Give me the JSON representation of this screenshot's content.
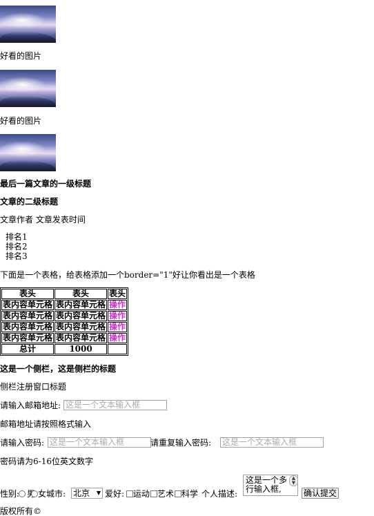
{
  "images": [
    {
      "caption": "好看的图片"
    },
    {
      "caption": "好看的图片"
    },
    {
      "caption": ""
    }
  ],
  "article": {
    "h1": "最后一篇文章的一级标题",
    "h2": "文章的二级标题",
    "meta": "文章作者 文章发表时间",
    "ranks": [
      "排名1",
      "排名2",
      "排名3"
    ],
    "table_intro": "下面是一个表格，给表格添加一个border=\"1\"好让你看出是一个表格"
  },
  "table": {
    "headers": [
      "表头",
      "表头",
      "表头"
    ],
    "rows": [
      [
        "表内容单元格",
        "表内容单元格",
        "操作"
      ],
      [
        "表内容单元格",
        "表内容单元格",
        "操作"
      ],
      [
        "表内容单元格",
        "表内容单元格",
        "操作"
      ],
      [
        "表内容单元格",
        "表内容单元格",
        "操作"
      ]
    ],
    "footer": [
      "总计",
      "1000",
      ""
    ]
  },
  "sidebar": {
    "title": "这是一个侧栏，这是侧栏的标题",
    "window_title": "侧栏注册窗口标题"
  },
  "form": {
    "email_label": "请输入邮箱地址:",
    "email_placeholder": "这是一个文本输入框",
    "email_hint": "邮箱地址请按照格式输入",
    "password_label": "请输入密码:",
    "password_placeholder": "这是一个文本输入框",
    "password2_label": "请重复输入密码:",
    "password2_placeholder": "这是一个文本输入框",
    "password_hint": "密码请为6-16位英文数字",
    "gender_label": "性别:",
    "gender_male": "男",
    "gender_female": "女",
    "city_label": "城市:",
    "city_value": "北京",
    "hobby_label": "爱好:",
    "hobbies": [
      "运动",
      "艺术",
      "科学"
    ],
    "desc_label": "个人描述:",
    "desc_value": "这是一个多\n行输入框,",
    "submit_label": "确认提交"
  },
  "footer": {
    "copyright": "版权所有©"
  }
}
